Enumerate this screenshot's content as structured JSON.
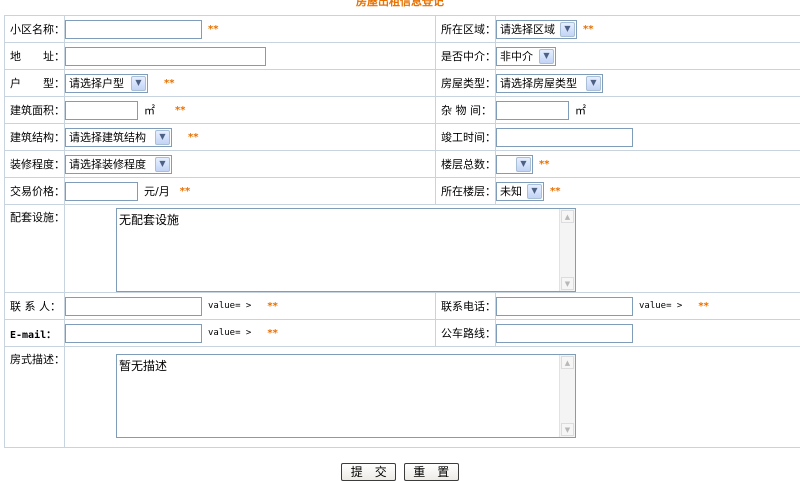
{
  "title": "房屋出租信息登记",
  "required_mark": "**",
  "fields": {
    "community_label": "小区名称：",
    "area_label": "所在区域：",
    "area_select": "请选择区域",
    "address_label": "地　　址：",
    "agent_label": "是否中介：",
    "agent_select": "非中介",
    "unit_type_label": "户　　型：",
    "unit_type_select": "请选择户型",
    "house_type_label": "房屋类型：",
    "house_type_select": "请选择房屋类型",
    "floor_area_label": "建筑面积：",
    "floor_area_unit": "㎡",
    "storage_label": "杂 物 间：",
    "storage_unit": "㎡",
    "structure_label": "建筑结构：",
    "structure_select": "请选择建筑结构",
    "completion_label": "竣工时间：",
    "decoration_label": "装修程度：",
    "decoration_select": "请选择装修程度",
    "total_floors_label": "楼层总数：",
    "total_floors_select": "",
    "price_label": "交易价格：",
    "price_unit": "元/月",
    "floor_label": "所在楼层：",
    "floor_select": "未知",
    "facilities_label": "配套设施：",
    "facilities_value": "无配套设施",
    "contact_label": "联 系 人：",
    "contact_suffix": "value= >",
    "phone_label": "联系电话：",
    "phone_suffix": "value= >",
    "email_label": "E-mail：",
    "email_suffix": "value= >",
    "bus_label": "公车路线：",
    "description_label": "房式描述：",
    "description_value": "暂无描述"
  },
  "buttons": {
    "submit": "提　交",
    "reset": "重　置"
  },
  "colors": {
    "accent": "#e87100",
    "border": "#c7d3df",
    "input_border": "#7f9db9"
  }
}
